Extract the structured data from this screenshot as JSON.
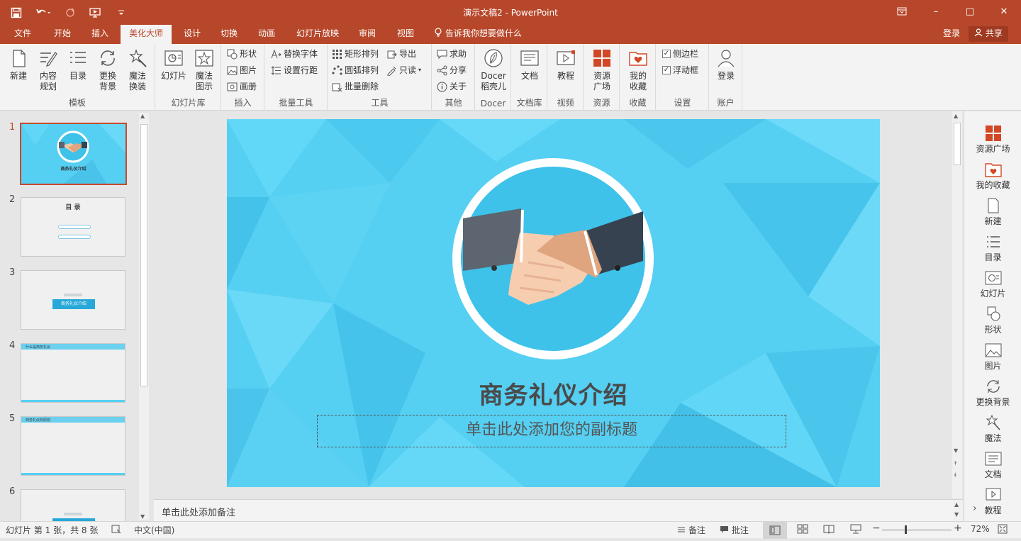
{
  "window": {
    "title": "演示文稿2 - PowerPoint",
    "minimize": "–",
    "maximize": "□",
    "close": "✕"
  },
  "tabs": [
    "文件",
    "开始",
    "插入",
    "美化大师",
    "设计",
    "切换",
    "动画",
    "幻灯片放映",
    "审阅",
    "视图"
  ],
  "active_tab": "美化大师",
  "tellme": "告诉我你想要做什么",
  "account": {
    "login": "登录",
    "share": "共享"
  },
  "ribbon": {
    "template_group": {
      "label": "模板",
      "buttons": [
        "新建",
        "内容\n规划",
        "目录",
        "更换\n背景",
        "魔法\n换装"
      ]
    },
    "slidelib_group": {
      "label": "幻灯片库",
      "buttons": [
        "幻灯片",
        "魔法\n图示"
      ]
    },
    "insert_group": {
      "label": "插入",
      "items": [
        "形状",
        "图片",
        "画册"
      ]
    },
    "batch_group": {
      "label": "批量工具",
      "items": [
        "替换字体",
        "设置行距"
      ]
    },
    "tools_group": {
      "label": "工具",
      "items": [
        "矩形排列",
        "导出",
        "圆弧排列",
        "只读",
        "批量删除"
      ]
    },
    "other_group": {
      "label": "其他",
      "items": [
        "求助",
        "分享",
        "关于"
      ]
    },
    "docer_group": {
      "label": "Docer",
      "button": "Docer\n稻壳儿"
    },
    "doclib_group": {
      "label": "文档库",
      "button": "文档"
    },
    "video_group": {
      "label": "视频",
      "button": "教程"
    },
    "resource_group": {
      "label": "资源",
      "button": "资源\n广场"
    },
    "fav_group": {
      "label": "收藏",
      "button": "我的\n收藏"
    },
    "settings_group": {
      "label": "设置",
      "items": [
        "侧边栏",
        "浮动框"
      ]
    },
    "account_group": {
      "label": "账户",
      "button": "登录"
    }
  },
  "thumbnails": [
    {
      "num": "1",
      "text": "商务礼仪介绍"
    },
    {
      "num": "2",
      "text": "目 录"
    },
    {
      "num": "3",
      "text": "商务礼仪介绍"
    },
    {
      "num": "4",
      "text": "什么是商务礼仪"
    },
    {
      "num": "5",
      "text": "商务礼仪的原则"
    },
    {
      "num": "6",
      "text": ""
    }
  ],
  "slide": {
    "title": "商务礼仪介绍",
    "subtitle_placeholder": "单击此处添加您的副标题"
  },
  "notes_placeholder": "单击此处添加备注",
  "sidepane": [
    "资源广场",
    "我的收藏",
    "新建",
    "目录",
    "幻灯片",
    "形状",
    "图片",
    "更换背景",
    "魔法",
    "文档",
    "教程"
  ],
  "status": {
    "slide_info": "幻灯片 第 1 张，共 8 张",
    "language": "中文(中国)",
    "notes": "备注",
    "comments": "批注",
    "zoom": "72%"
  },
  "colors": {
    "accent": "#b7472a",
    "slide_bg": "#55cff2",
    "title": "#4a4a4a"
  }
}
